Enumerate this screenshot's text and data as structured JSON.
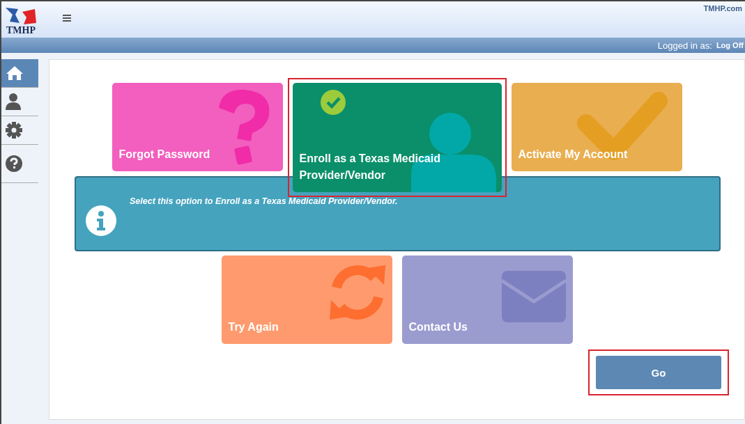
{
  "header": {
    "logo_text": "TMHP",
    "site_link": "TMHP.com"
  },
  "user_bar": {
    "label": "Logged in as:",
    "action": "Log Off"
  },
  "sidebar": {
    "items": [
      {
        "kind": "home",
        "selected": true
      },
      {
        "kind": "user",
        "selected": false
      },
      {
        "kind": "settings",
        "selected": false
      },
      {
        "kind": "help",
        "selected": false
      }
    ]
  },
  "tiles_top": [
    {
      "label": "Forgot Password",
      "kind": "question",
      "color": "#f25fbe",
      "selected": false
    },
    {
      "label": "Enroll as a Texas Medicaid Provider/Vendor",
      "kind": "person",
      "color": "#0a8f6a",
      "selected": true
    },
    {
      "label": "Activate My Account",
      "kind": "check",
      "color": "#e9ae50",
      "selected": false
    }
  ],
  "info": {
    "text": "Select this option to Enroll as a Texas Medicaid Provider/Vendor."
  },
  "tiles_bottom": [
    {
      "label": "Try Again",
      "kind": "refresh",
      "color": "#fe9a6e",
      "selected": false
    },
    {
      "label": "Contact Us",
      "kind": "envelope",
      "color": "#9a9bcf",
      "selected": false
    }
  ],
  "go_button": {
    "label": "Go",
    "highlighted": true
  }
}
